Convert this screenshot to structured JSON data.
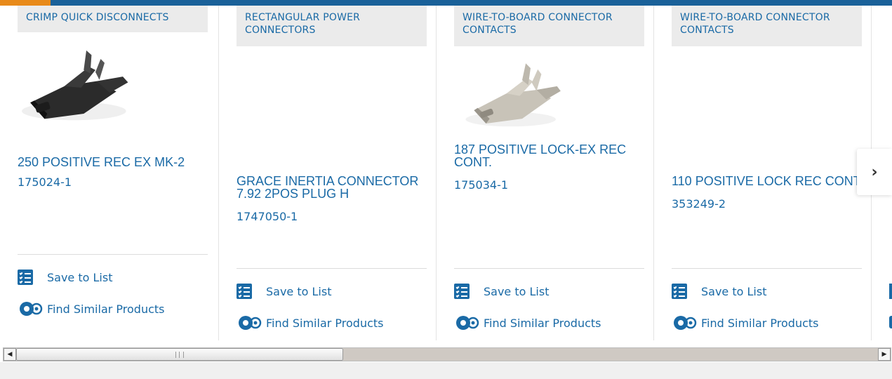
{
  "cards": [
    {
      "category": "CRIMP QUICK DISCONNECTS",
      "title": "250 POSITIVE REC EX MK-2",
      "part_number": "175024-1",
      "has_image": true,
      "image_tone": "dark",
      "save_label": "Save to List",
      "similar_label": "Find Similar Products"
    },
    {
      "category": "RECTANGULAR POWER CONNECTORS",
      "title": "GRACE INERTIA CONNECTOR 7.92 2POS PLUG H",
      "part_number": "1747050-1",
      "has_image": false,
      "save_label": "Save to List",
      "similar_label": "Find Similar Products"
    },
    {
      "category": "WIRE-TO-BOARD CONNECTOR CONTACTS",
      "title": "187 POSITIVE LOCK-EX REC CONT.",
      "part_number": "175034-1",
      "has_image": true,
      "image_tone": "silver",
      "save_label": "Save to List",
      "similar_label": "Find Similar Products"
    },
    {
      "category": "WIRE-TO-BOARD CONNECTOR CONTACTS",
      "title": "110 POSITIVE LOCK REC CONT",
      "part_number": "353249-2",
      "has_image": false,
      "save_label": "Save to List",
      "similar_label": "Find Similar Products"
    }
  ],
  "navigation": {
    "next_icon": "chevron-right-icon",
    "next_glyph": "›"
  },
  "colors": {
    "brand_blue": "#1a6aa6",
    "top_bar": "#1a6199",
    "top_accent": "#e88a1a",
    "category_bg": "#ebebeb"
  }
}
